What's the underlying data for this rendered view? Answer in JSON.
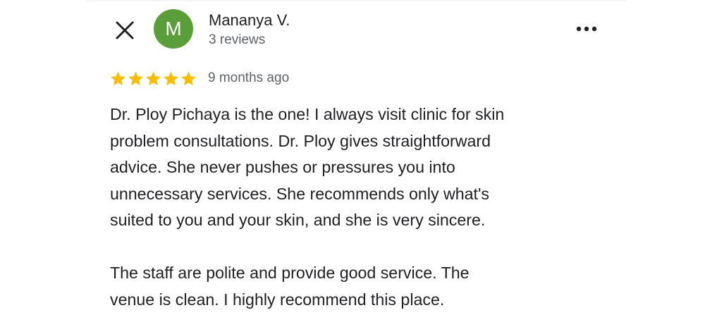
{
  "header": {
    "close_icon": "close-icon",
    "more_icon": "more-horizontal-icon"
  },
  "reviewer": {
    "initial": "M",
    "avatar_color": "#5a9e3a",
    "name": "Mananya V.",
    "review_count": "3 reviews"
  },
  "review": {
    "rating": 5,
    "rating_max": 5,
    "star_color": "#fbbc04",
    "date": "9 months ago",
    "paragraphs": [
      "Dr. Ploy Pichaya is the one! I always visit clinic for skin\nproblem consultations. Dr. Ploy gives straightforward\nadvice. She never pushes or pressures you into\nunnecessary services. She recommends only what's\nsuited to you and your skin, and she is very sincere.",
      "The staff are polite and provide good service. The\nvenue is clean. I highly recommend this place."
    ]
  }
}
